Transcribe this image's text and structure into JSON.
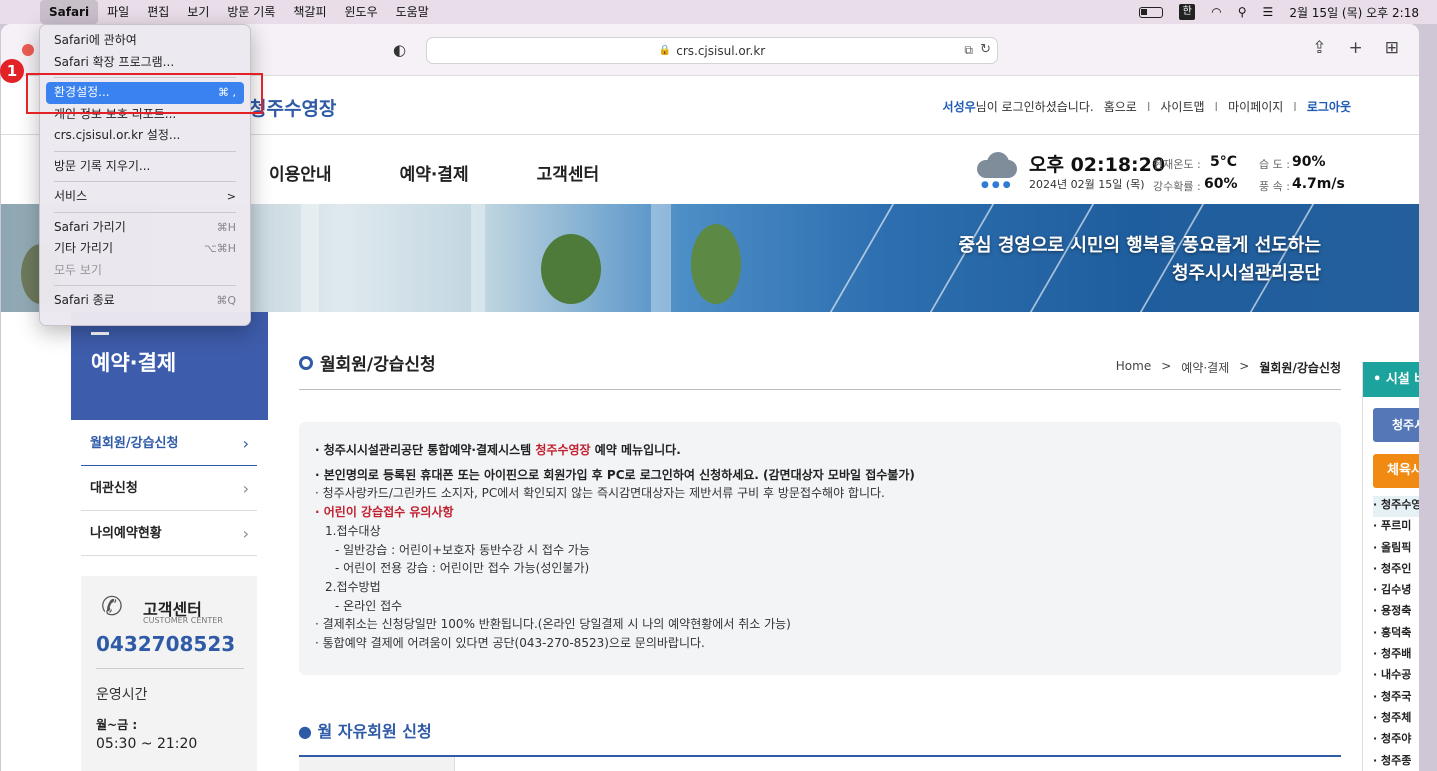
{
  "menubar": {
    "app": "Safari",
    "items": [
      "파일",
      "편집",
      "보기",
      "방문 기록",
      "책갈피",
      "윈도우",
      "도움말"
    ],
    "ime": "한",
    "clock": "2월 15일 (목) 오후 2:18"
  },
  "browser": {
    "url": "crs.cjsisul.or.kr"
  },
  "safari_menu": {
    "items": [
      {
        "label": "Safari에 관하여",
        "shortcut": ""
      },
      {
        "label": "Safari 확장 프로그램...",
        "shortcut": ""
      },
      {
        "label": "환경설정...",
        "shortcut": "⌘ ,"
      },
      {
        "label": "개인 정보 보호 리포트...",
        "shortcut": ""
      },
      {
        "label": "crs.cjsisul.or.kr 설정...",
        "shortcut": ""
      },
      {
        "label": "방문 기록 지우기...",
        "shortcut": ""
      },
      {
        "label": "서비스",
        "shortcut": ">"
      },
      {
        "label": "Safari 가리기",
        "shortcut": "⌘H"
      },
      {
        "label": "기타 가리기",
        "shortcut": "⌥⌘H"
      },
      {
        "label": "모두 보기",
        "shortcut": ""
      },
      {
        "label": "Safari 종료",
        "shortcut": "⌘Q"
      }
    ]
  },
  "annotation": {
    "badge": "1"
  },
  "site": {
    "logo": "청주수영장",
    "util": {
      "user": "서성우",
      "login_msg": "님이 로그인하셨습니다.",
      "home": "홈으로",
      "sitemap": "사이트맵",
      "mypage": "마이페이지",
      "logout": "로그아웃",
      "sep": "I"
    },
    "gnb": [
      "이용안내",
      "예약·결제",
      "고객센터"
    ],
    "weather": {
      "time": "오후 02:18:20",
      "date": "2024년 02월 15일 (목)",
      "temp_label": "현재온도 :",
      "temp": "5°C",
      "rain_label": "강수확률 :",
      "rain": "60%",
      "humid_label": "습 도 :",
      "humid": "90%",
      "wind_label": "풍 속 :",
      "wind": "4.7m/s"
    },
    "banner": {
      "line1": "중심 경영으로 시민의 행복을 풍요롭게 선도하는",
      "line2": "청주시시설관리공단"
    },
    "lnb": {
      "title": "예약·결제",
      "items": [
        "월회원/강습신청",
        "대관신청",
        "나의예약현황"
      ]
    },
    "cs": {
      "title": "고객센터",
      "subtitle": "CUSTOMER CENTER",
      "phone": "0432708523",
      "hours_label": "운영시간",
      "days": "월~금 :",
      "time": "05:30 ~ 21:20"
    },
    "page_title": "월회원/강습신청",
    "breadcrumb": {
      "home": "Home",
      "sep": ">",
      "level1": "예약·결제",
      "current": "월회원/강습신청"
    },
    "notice": {
      "l1_pre": "· 청주시시설관리공단 통합예약·결제시스템 ",
      "l1_red": "청주수영장",
      "l1_post": " 예약 메뉴입니다.",
      "l2": "· 본인명의로 등록된 휴대폰 또는 아이핀으로 회원가입 후 PC로 로그인하여 신청하세요. (감면대상자 모바일 접수불가)",
      "l3": "· 청주사랑카드/그린카드 소지자, PC에서 확인되지 않는 즉시감면대상자는 제반서류 구비 후 방문접수해야 합니다.",
      "l4": "· 어린이 강습접수 유의사항",
      "l5": "1.접수대상",
      "l6": "- 일반강습 : 어린이+보호자 동반수강 시 접수 가능",
      "l7": "- 어린이 전용 강습 : 어린이만 접수 가능(성인불가)",
      "l8": "2.접수방법",
      "l9": "- 온라인 접수",
      "l10": "· 결제취소는 신청당일만 100% 반환됩니다.(온라인 당일결제 시 나의 예약현황에서 취소 가능)",
      "l11": "· 통합예약 결제에 어려움이 있다면 공단(043-270-8523)으로 문의바랍니다."
    },
    "section_title": "● 월 자유회원 신청",
    "quick": {
      "head": "• 시설 바로가기",
      "btn1": "청주시",
      "btn2": "체육시설",
      "list": [
        "· 청주수영장",
        "· 푸르미",
        "· 올림픽",
        "· 청주인",
        "· 김수녕",
        "· 용정축",
        "· 흥덕축",
        "· 청주배",
        "· 내수공",
        "· 청주국",
        "· 청주체",
        "· 청주야",
        "· 청주종"
      ]
    }
  }
}
